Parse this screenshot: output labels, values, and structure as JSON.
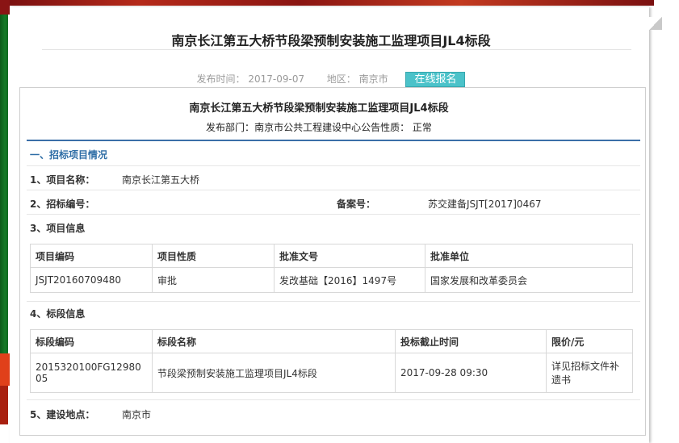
{
  "page": {
    "title": "南京长江第五大桥节段梁预制安装施工监理项目JL4标段",
    "publish_time_label": "发布时间：",
    "publish_time": "2017-09-07",
    "region_label": "地区：",
    "region": "南京市",
    "signup_button": "在线报名"
  },
  "notice": {
    "title": "南京长江第五大桥节段梁预制安装施工监理项目JL4标段",
    "dept_label": "发布部门：",
    "dept": "南京市公共工程建设中心",
    "nature_label": "公告性质：",
    "nature": "正常"
  },
  "section1": {
    "heading": "一、招标项目情况",
    "project_name_label": "1、项目名称：",
    "project_name": "南京长江第五大桥",
    "tender_no_label": "2、招标编号：",
    "tender_no": "",
    "record_no_label": "备案号：",
    "record_no": "苏交建备JSJT[2017]0467",
    "project_info_label": "3、项目信息",
    "project_table": {
      "headers": [
        "项目编码",
        "项目性质",
        "批准文号",
        "批准单位"
      ],
      "row": [
        "JSJT20160709480",
        "审批",
        "发改基础【2016】1497号",
        "国家发展和改革委员会"
      ]
    },
    "lot_info_label": "4、标段信息",
    "lot_table": {
      "headers": [
        "标段编码",
        "标段名称",
        "投标截止时间",
        "限价/元"
      ],
      "row": [
        "2015320100FG12980 05",
        "节段梁预制安装施工监理项目JL4标段",
        "2017-09-28 09:30",
        "详见招标文件补遗书"
      ]
    },
    "location_label": "5、建设地点：",
    "location": "南京市"
  }
}
